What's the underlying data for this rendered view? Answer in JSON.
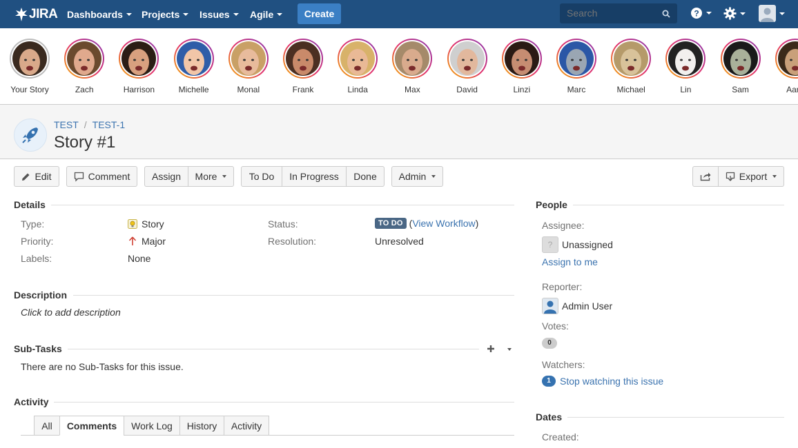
{
  "nav": {
    "logo": "JIRA",
    "menus": [
      "Dashboards",
      "Projects",
      "Issues",
      "Agile"
    ],
    "create_label": "Create",
    "search_placeholder": "Search"
  },
  "stories": [
    {
      "name": "Your Story",
      "skin": "#d9a98a",
      "hair": "#3a2a1f",
      "ring": "plain"
    },
    {
      "name": "Zach",
      "skin": "#e0a98d",
      "hair": "#6b4a2e",
      "ring": "grad"
    },
    {
      "name": "Harrison",
      "skin": "#d8a07f",
      "hair": "#2b1d15",
      "ring": "grad"
    },
    {
      "name": "Michelle",
      "skin": "#f2c6a8",
      "hair": "#2f5da8",
      "ring": "grad"
    },
    {
      "name": "Monal",
      "skin": "#e8bb9c",
      "hair": "#c9a066",
      "ring": "grad"
    },
    {
      "name": "Frank",
      "skin": "#c98a6a",
      "hair": "#4b2f22",
      "ring": "grad"
    },
    {
      "name": "Linda",
      "skin": "#e9b996",
      "hair": "#d8b26a",
      "ring": "grad"
    },
    {
      "name": "Max",
      "skin": "#d9ab8d",
      "hair": "#a58a6a",
      "ring": "grad"
    },
    {
      "name": "David",
      "skin": "#e2b89d",
      "hair": "#cfcfcf",
      "ring": "grad"
    },
    {
      "name": "Linzi",
      "skin": "#c68d72",
      "hair": "#2a1a14",
      "ring": "grad"
    },
    {
      "name": "Marc",
      "skin": "#9aa6b3",
      "hair": "#2b57a6",
      "ring": "grad"
    },
    {
      "name": "Michael",
      "skin": "#d8c29a",
      "hair": "#b59a6a",
      "ring": "grad"
    },
    {
      "name": "Lin",
      "skin": "#f2f0ee",
      "hair": "#222222",
      "ring": "grad"
    },
    {
      "name": "Sam",
      "skin": "#a9b19a",
      "hair": "#1a1a1a",
      "ring": "grad"
    },
    {
      "name": "Aaro",
      "skin": "#c9a07a",
      "hair": "#3b2a1a",
      "ring": "grad"
    }
  ],
  "issue": {
    "project": "TEST",
    "key": "TEST-1",
    "title": "Story #1"
  },
  "toolbar": {
    "edit": "Edit",
    "comment": "Comment",
    "assign": "Assign",
    "more": "More",
    "todo": "To Do",
    "in_progress": "In Progress",
    "done": "Done",
    "admin": "Admin",
    "export": "Export"
  },
  "details": {
    "heading": "Details",
    "type_label": "Type:",
    "type_value": "Story",
    "priority_label": "Priority:",
    "priority_value": "Major",
    "labels_label": "Labels:",
    "labels_value": "None",
    "status_label": "Status:",
    "status_value": "TO DO",
    "view_workflow": "View Workflow",
    "resolution_label": "Resolution:",
    "resolution_value": "Unresolved"
  },
  "description": {
    "heading": "Description",
    "placeholder": "Click to add description"
  },
  "subtasks": {
    "heading": "Sub-Tasks",
    "empty": "There are no Sub-Tasks for this issue."
  },
  "activity": {
    "heading": "Activity",
    "tabs": [
      "All",
      "Comments",
      "Work Log",
      "History",
      "Activity"
    ],
    "active_tab": "Comments"
  },
  "people": {
    "heading": "People",
    "assignee_label": "Assignee:",
    "assignee_value": "Unassigned",
    "assign_to_me": "Assign to me",
    "reporter_label": "Reporter:",
    "reporter_value": "Admin User",
    "votes_label": "Votes:",
    "votes_count": "0",
    "watchers_label": "Watchers:",
    "watchers_count": "1",
    "stop_watching": "Stop watching this issue"
  },
  "dates": {
    "heading": "Dates",
    "created_label": "Created:"
  },
  "colors": {
    "nav_bg": "#205081",
    "create_bg": "#3b7fc4",
    "link": "#3b73af",
    "lozenge": "#4a6785"
  }
}
